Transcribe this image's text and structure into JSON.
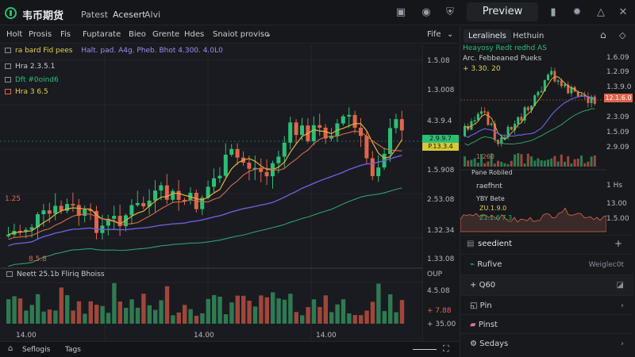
{
  "topbar": {
    "title": "韦币期货",
    "nav": [
      "Patest",
      "Acesert",
      "Alvi"
    ],
    "preview_label": "Preview"
  },
  "toolbar": {
    "items": [
      "Holt",
      "Prosis",
      "Fis",
      "Fuptarate",
      "Bieo",
      "Grente",
      "Hdes",
      "Snaiot proviso"
    ],
    "right_label": "Fife"
  },
  "chart": {
    "legends": [
      {
        "text": "ra bard   Fid pees",
        "sub": "Halt. pad. A4g. Pheb. Bhot 4.300. 4.0L0"
      },
      {
        "text": "Hra 2.3.5.1"
      },
      {
        "text": "Dft #0oind6"
      },
      {
        "text": "Hra 3 6.5"
      }
    ],
    "price_ticks": [
      "1.5.08",
      "1.3.008",
      "4.3.9.4",
      "1.5.908",
      "2.53.08",
      "1.32.34",
      "1.33.08",
      "OUP",
      "4.5.08",
      "+ 7.88",
      "+ 35.00"
    ],
    "price_markers": [
      "2.9.9.7",
      "P.13.3.4"
    ],
    "time_ticks": [
      "14.00",
      "14.00",
      "14.00"
    ],
    "left_markers": [
      "1.25",
      "8.5.8"
    ],
    "volume_legend": "Neett  25.1b Fliriq  Bhoiss",
    "accent": "#2bbf76",
    "down_color": "#e0654c"
  },
  "statusbar": {
    "left": "Seflogis",
    "mid": "Tags"
  },
  "side": {
    "tabs": [
      "Leralinels",
      "Hethuin"
    ],
    "info_lines": [
      "Heayosy  Redt redhd AS",
      "Arc. Febbeaned Pueks",
      "+ 3.30.  20"
    ],
    "mini_ticks": [
      "1.6.09",
      "1.2.09",
      "1.3.9.0",
      "2.3.09",
      "1.5.09",
      "2.9.09",
      "1 Hs",
      "13.00",
      "1.5.00"
    ],
    "mini_marker": "12.1.6.0",
    "mini_markers_left": [
      "1.260",
      "Pane   Robiled"
    ],
    "detail_lines": [
      "raefhnt",
      "YBY  Bete",
      "ZU.1.9.0",
      "Z1.1.6 7.3"
    ],
    "section_title": "seedient",
    "menu": [
      {
        "label": "Rufive",
        "right": "Weiglec0t"
      },
      {
        "label": "Q60",
        "right": ""
      },
      {
        "label": "Pin",
        "right": ""
      },
      {
        "label": "Pinst",
        "right": ""
      },
      {
        "label": "Sedays",
        "right": ""
      }
    ]
  }
}
